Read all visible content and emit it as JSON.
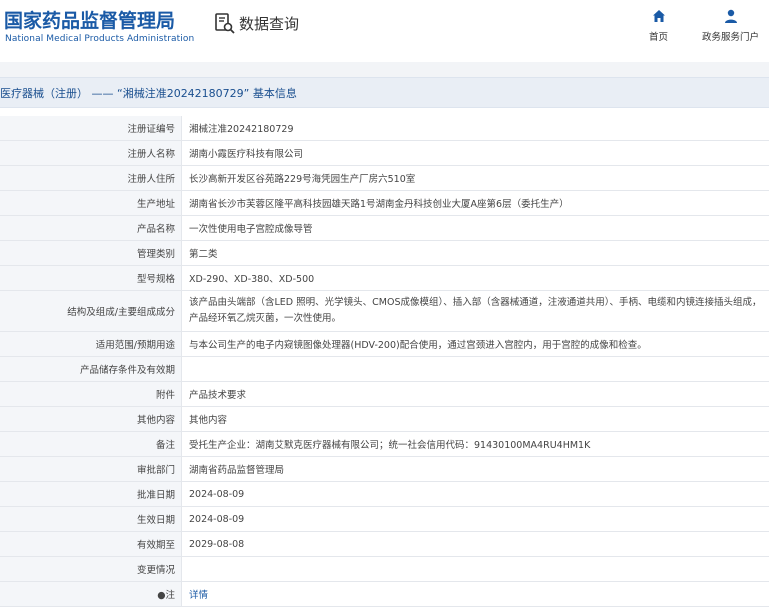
{
  "header": {
    "logo_cn": "国家药品监督管理局",
    "logo_en": "National Medical Products Administration",
    "section": "数据查询",
    "nav": [
      {
        "label": "首页"
      },
      {
        "label": "政务服务门户"
      }
    ]
  },
  "breadcrumb": "医疗器械（注册） —— “湘械注准20242180729” 基本信息",
  "rows": [
    {
      "label": "注册证编号",
      "value": "湘械注准20242180729"
    },
    {
      "label": "注册人名称",
      "value": "湖南小霞医疗科技有限公司"
    },
    {
      "label": "注册人住所",
      "value": "长沙高新开发区谷苑路229号海凭园生产厂房六510室"
    },
    {
      "label": "生产地址",
      "value": "湖南省长沙市芙蓉区隆平高科技园雄天路1号湖南金丹科技创业大厦A座第6层（委托生产）"
    },
    {
      "label": "产品名称",
      "value": "一次性使用电子宫腔成像导管"
    },
    {
      "label": "管理类别",
      "value": "第二类"
    },
    {
      "label": "型号规格",
      "value": "XD-290、XD-380、XD-500"
    },
    {
      "label": "结构及组成/主要组成成分",
      "value": "该产品由头端部（含LED 照明、光学镜头、CMOS成像模组）、插入部（含器械通道，注液通道共用）、手柄、电缆和内镜连接插头组成，产品经环氧乙烷灭菌，一次性使用。"
    },
    {
      "label": "适用范围/预期用途",
      "value": "与本公司生产的电子内窥镜图像处理器(HDV-200)配合使用，通过宫颈进入宫腔内，用于宫腔的成像和检查。"
    },
    {
      "label": "产品储存条件及有效期",
      "value": ""
    },
    {
      "label": "附件",
      "value": "产品技术要求"
    },
    {
      "label": "其他内容",
      "value": "其他内容"
    },
    {
      "label": "备注",
      "value": "受托生产企业：湖南艾默克医疗器械有限公司；统一社会信用代码：91430100MA4RU4HM1K"
    },
    {
      "label": "审批部门",
      "value": "湖南省药品监督管理局"
    },
    {
      "label": "批准日期",
      "value": "2024-08-09"
    },
    {
      "label": "生效日期",
      "value": "2024-08-09"
    },
    {
      "label": "有效期至",
      "value": "2029-08-08"
    },
    {
      "label": "变更情况",
      "value": ""
    },
    {
      "label": "●注",
      "value": "详情"
    }
  ]
}
